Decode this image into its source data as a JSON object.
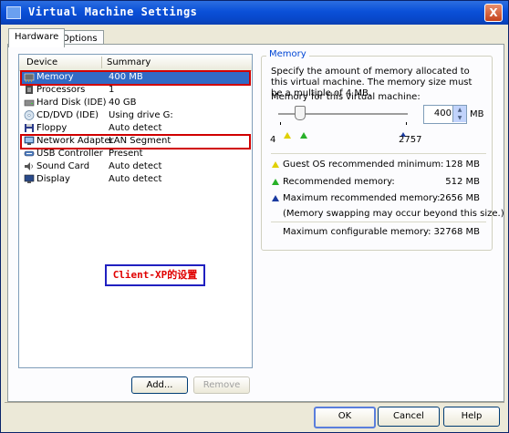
{
  "window": {
    "title": "Virtual Machine Settings",
    "close_label": "X"
  },
  "tabs": [
    {
      "label": "Hardware",
      "active": true
    },
    {
      "label": "Options",
      "active": false
    }
  ],
  "device_list": {
    "columns": [
      "Device",
      "Summary"
    ],
    "rows": [
      {
        "device": "Memory",
        "summary": "400 MB",
        "icon": "memory-icon",
        "selected": true
      },
      {
        "device": "Processors",
        "summary": "1",
        "icon": "processor-icon"
      },
      {
        "device": "Hard Disk (IDE)",
        "summary": "40 GB",
        "icon": "hard-disk-icon"
      },
      {
        "device": "CD/DVD (IDE)",
        "summary": "Using drive G:",
        "icon": "cd-dvd-icon"
      },
      {
        "device": "Floppy",
        "summary": "Auto detect",
        "icon": "floppy-icon"
      },
      {
        "device": "Network Adapter",
        "summary": "LAN Segment",
        "icon": "network-adapter-icon"
      },
      {
        "device": "USB Controller",
        "summary": "Present",
        "icon": "usb-icon"
      },
      {
        "device": "Sound Card",
        "summary": "Auto detect",
        "icon": "sound-card-icon"
      },
      {
        "device": "Display",
        "summary": "Auto detect",
        "icon": "display-icon"
      }
    ],
    "add_button": "Add...",
    "remove_button": "Remove"
  },
  "annotation": {
    "text": "Client-XP的设置",
    "color": "#e00000",
    "border_color": "#2020c0"
  },
  "memory": {
    "group_title": "Memory",
    "description": "Specify the amount of memory allocated to this virtual machine. The memory size must be a multiple of 4 MB.",
    "field_label": "Memory for this virtual machine:",
    "value": "400",
    "unit": "MB",
    "slider_min": "4",
    "slider_max": "2757",
    "guest_os_label": "Guest OS recommended minimum:",
    "guest_os_value": "128 MB",
    "recommended_label": "Recommended memory:",
    "recommended_value": "512 MB",
    "max_recommended_label": "Maximum recommended memory:",
    "max_recommended_value": "2656 MB",
    "swap_note": "(Memory swapping may occur beyond this size.)",
    "max_configurable_label": "Maximum configurable memory:",
    "max_configurable_value": "32768 MB",
    "marker_colors": {
      "guest_min": "#e0d000",
      "recommended": "#28b028",
      "max_recommended": "#1a3aa0"
    }
  },
  "footer": {
    "ok": "OK",
    "cancel": "Cancel",
    "help": "Help"
  },
  "colors": {
    "title_bar": "#0a50d8",
    "selection": "#316ac5",
    "highlight_box": "#d00000"
  }
}
